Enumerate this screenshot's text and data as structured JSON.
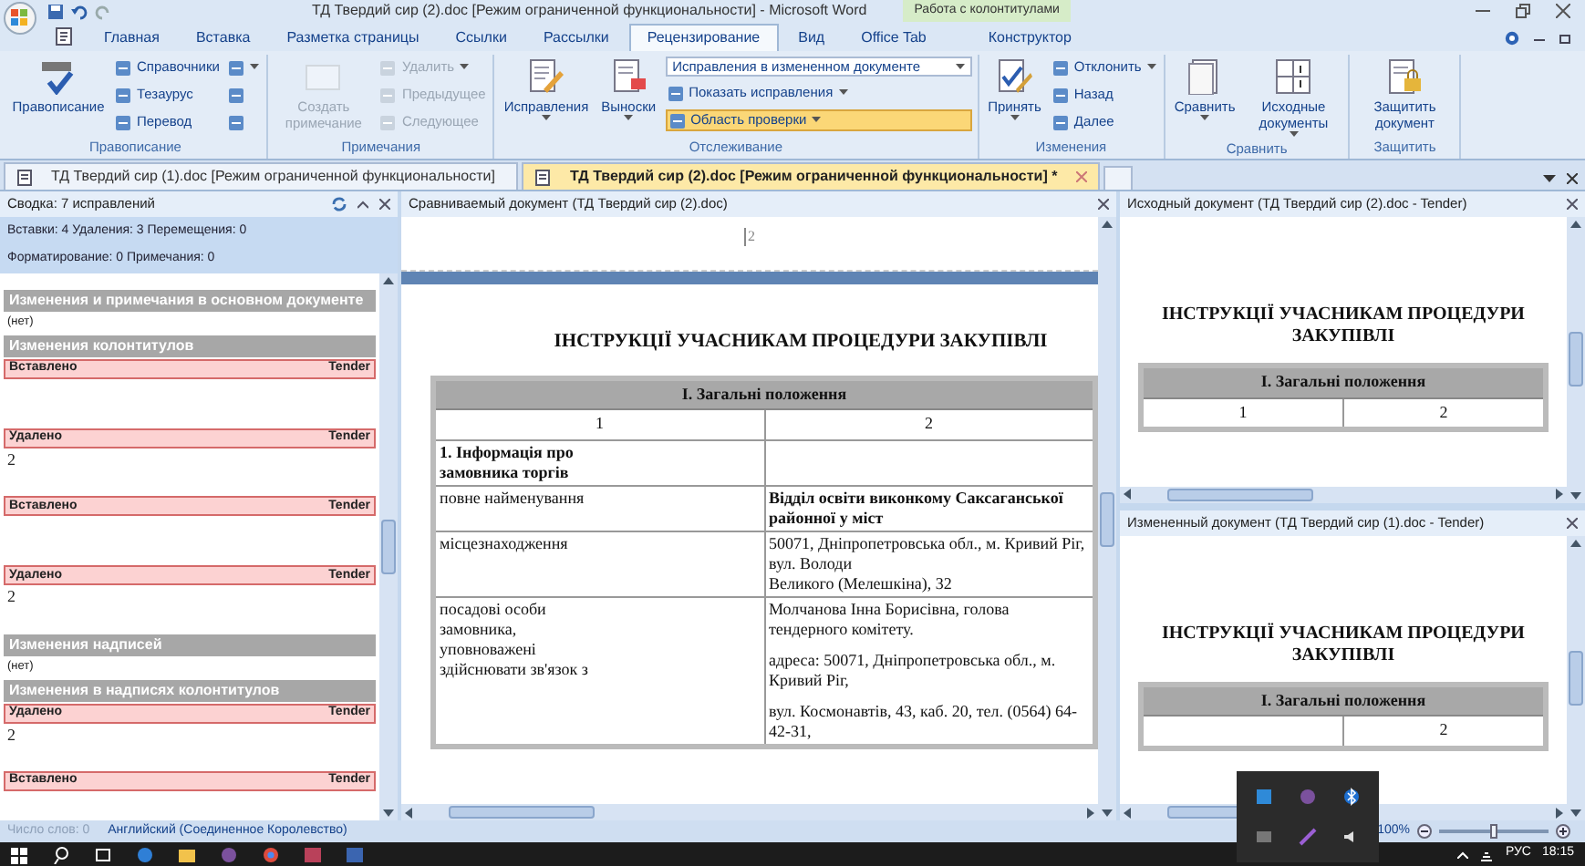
{
  "window": {
    "title": "ТД Твердий сир (2).doc [Режим ограниченной функциональности] - Microsoft Word",
    "contextual_tab": "Работа с колонтитулами"
  },
  "ribbon_tabs": [
    {
      "label": "Главная",
      "selected": false
    },
    {
      "label": "Вставка",
      "selected": false
    },
    {
      "label": "Разметка страницы",
      "selected": false
    },
    {
      "label": "Ссылки",
      "selected": false
    },
    {
      "label": "Рассылки",
      "selected": false
    },
    {
      "label": "Рецензирование",
      "selected": true
    },
    {
      "label": "Вид",
      "selected": false
    },
    {
      "label": "Office Tab",
      "selected": false
    },
    {
      "label": "Конструктор",
      "selected": false
    }
  ],
  "ribbon_groups": [
    {
      "label": "Правописание",
      "items": [
        {
          "kind": "large",
          "label": "Правописание",
          "disabled": false,
          "highlighted": false,
          "menu": false
        },
        {
          "kind": "small",
          "label": "Справочники",
          "disabled": false,
          "highlighted": false,
          "menu": false
        },
        {
          "kind": "small",
          "label": "Тезаурус",
          "disabled": false,
          "highlighted": false,
          "menu": false
        },
        {
          "kind": "small",
          "label": "Перевод",
          "disabled": false,
          "highlighted": false,
          "menu": false
        },
        {
          "kind": "icon",
          "disabled": false,
          "highlighted": false,
          "menu": true
        },
        {
          "kind": "icon",
          "disabled": false,
          "highlighted": false,
          "menu": false
        },
        {
          "kind": "icon",
          "disabled": false,
          "highlighted": false,
          "menu": false
        }
      ]
    },
    {
      "label": "Примечания",
      "items": [
        {
          "kind": "large",
          "label": "Создать примечание",
          "disabled": true,
          "highlighted": false,
          "menu": false
        },
        {
          "kind": "small",
          "label": "Удалить",
          "disabled": true,
          "highlighted": false,
          "menu": true
        },
        {
          "kind": "small",
          "label": "Предыдущее",
          "disabled": true,
          "highlighted": false,
          "menu": false
        },
        {
          "kind": "small",
          "label": "Следующее",
          "disabled": true,
          "highlighted": false,
          "menu": false
        }
      ]
    },
    {
      "label": "Отслеживание",
      "items": [
        {
          "kind": "large",
          "label": "Исправления",
          "disabled": false,
          "highlighted": false,
          "menu": true
        },
        {
          "kind": "large",
          "label": "Выноски",
          "disabled": false,
          "highlighted": false,
          "menu": true
        },
        {
          "kind": "combo",
          "label": "Исправления в измененном документе",
          "disabled": false,
          "highlighted": false,
          "menu": true
        },
        {
          "kind": "small",
          "label": "Показать исправления",
          "disabled": false,
          "highlighted": false,
          "menu": true
        },
        {
          "kind": "small",
          "label": "Область проверки",
          "disabled": false,
          "highlighted": true,
          "menu": true
        }
      ]
    },
    {
      "label": "Изменения",
      "items": [
        {
          "kind": "large",
          "label": "Принять",
          "disabled": false,
          "highlighted": false,
          "menu": true
        },
        {
          "kind": "small",
          "label": "Отклонить",
          "disabled": false,
          "highlighted": false,
          "menu": true
        },
        {
          "kind": "small",
          "label": "Назад",
          "disabled": false,
          "highlighted": false,
          "menu": false
        },
        {
          "kind": "small",
          "label": "Далее",
          "disabled": false,
          "highlighted": false,
          "menu": false
        }
      ]
    },
    {
      "label": "Сравнить",
      "items": [
        {
          "kind": "large",
          "label": "Сравнить",
          "disabled": false,
          "highlighted": false,
          "menu": true
        },
        {
          "kind": "large",
          "label": "Исходные документы",
          "disabled": false,
          "highlighted": false,
          "menu": true
        }
      ]
    },
    {
      "label": "Защитить",
      "items": [
        {
          "kind": "large",
          "label": "Защитить документ",
          "disabled": false,
          "highlighted": false,
          "menu": false
        }
      ]
    }
  ],
  "document_tabs": [
    {
      "label": "ТД Твердий сир (1).doc [Режим ограниченной функциональности]",
      "selected": false
    },
    {
      "label": "ТД Твердий сир (2).doc [Режим ограниченной функциональности] *",
      "selected": true
    }
  ],
  "review_pane": {
    "title": "Сводка: 7 исправлений",
    "stats": [
      "Вставки: 4 Удаления: 3 Перемещения: 0",
      "Форматирование: 0 Примечания: 0"
    ],
    "entries": [
      {
        "kind": "section",
        "text": "Изменения и примечания в основном документе"
      },
      {
        "kind": "note",
        "text": "(нет)"
      },
      {
        "kind": "section",
        "text": "Изменения колонтитулов"
      },
      {
        "kind": "change",
        "type": "Вставлено",
        "author": "Tender"
      },
      {
        "kind": "change",
        "type": "Удалено",
        "author": "Tender",
        "body": "2"
      },
      {
        "kind": "change",
        "type": "Вставлено",
        "author": "Tender"
      },
      {
        "kind": "change",
        "type": "Удалено",
        "author": "Tender",
        "body": "2"
      },
      {
        "kind": "section",
        "text": "Изменения надписей"
      },
      {
        "kind": "note",
        "text": "(нет)"
      },
      {
        "kind": "section",
        "text": "Изменения в надписях колонтитулов"
      },
      {
        "kind": "change",
        "type": "Удалено",
        "author": "Tender",
        "body": "2"
      },
      {
        "kind": "change",
        "type": "Вставлено",
        "author": "Tender"
      }
    ]
  },
  "compare_pane": {
    "title": "Сравниваемый документ (ТД Твердий сир (2).doc)",
    "header_text": "2",
    "heading": "ІНСТРУКЦІЇ УЧАСНИКАМ ПРОЦЕДУРИ ЗАКУПІВЛІ",
    "section": "І. Загальні положення",
    "column_numbers": [
      "1",
      "2"
    ],
    "rows": [
      {
        "cells": [
          {
            "lines": [
              "1. Інформація про",
              "замовника торгів"
            ],
            "bold": true
          }
        ]
      },
      {
        "cells": [
          {
            "lines": [
              "повне найменування"
            ],
            "bold": false
          },
          {
            "lines": [
              "Відділ освіти виконкому Саксаганської районної у міст"
            ],
            "bold": true
          }
        ]
      },
      {
        "cells": [
          {
            "lines": [
              "місцезнаходження"
            ],
            "bold": false
          },
          {
            "lines": [
              "50071, Дніпропетровська обл., м. Кривий Ріг, вул. Володи",
              "Великого (Мелешкіна), 32"
            ],
            "bold": false
          }
        ]
      },
      {
        "cells": [
          {
            "lines": [
              "посадові особи",
              "замовника,",
              "уповноважені",
              "здійснювати зв'язок з"
            ],
            "bold": false
          },
          {
            "lines": [
              "Молчанова Інна Борисівна, голова тендерного комітету.",
              "адреса: 50071, Дніпропетровська обл., м. Кривий Ріг,",
              "вул. Космонавтів, 43, каб. 20, тел. (0564) 64-42-31,"
            ],
            "bold": false
          }
        ]
      }
    ]
  },
  "source_panes": [
    {
      "title": "Исходный документ (ТД Твердий сир (2).doc - Tender)",
      "heading": "ІНСТРУКЦІЇ УЧАСНИКАМ ПРОЦЕДУРИ ЗАКУПІВЛІ",
      "section": "І. Загальні положення",
      "column_numbers": [
        "1",
        "2"
      ]
    },
    {
      "title": "Измененный документ (ТД Твердий сир (1).doc - Tender)",
      "heading": "ІНСТРУКЦІЇ УЧАСНИКАМ ПРОЦЕДУРИ ЗАКУПІВЛІ",
      "section": "І. Загальні положення",
      "column_numbers": [
        "2"
      ]
    }
  ],
  "status_bar": {
    "word_count": "Число слов: 0",
    "language": "Английский (Соединенное Королевство)",
    "zoom": "100%",
    "zoom_slider": {
      "level": 0.5
    }
  },
  "taskbar": {
    "language": "РУС",
    "time": "18:15"
  }
}
